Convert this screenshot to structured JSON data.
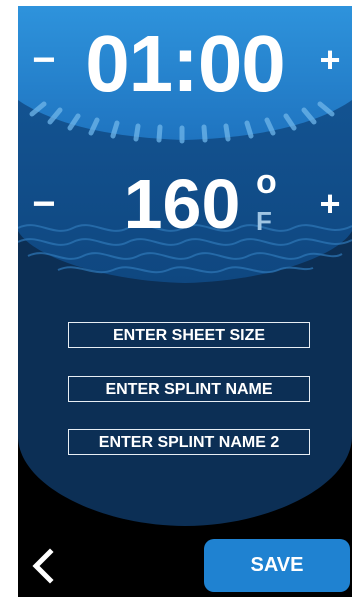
{
  "timer": {
    "minus_label": "−",
    "plus_label": "+",
    "value": "01:00"
  },
  "temperature": {
    "minus_label": "−",
    "plus_label": "+",
    "value": "160",
    "degree_symbol": "o",
    "unit": "F"
  },
  "fields": {
    "sheet_size": "ENTER SHEET SIZE",
    "splint_name": "ENTER SPLINT NAME",
    "splint_name_2": "ENTER SPLINT NAME 2"
  },
  "footer": {
    "back_icon": "chevron-left-icon",
    "save_label": "SAVE"
  },
  "colors": {
    "top_blue": "#2a8ad6",
    "mid_blue": "#12508e",
    "deep_blue": "#0c2f55",
    "save_blue": "#1f82d1",
    "background": "#000000"
  }
}
